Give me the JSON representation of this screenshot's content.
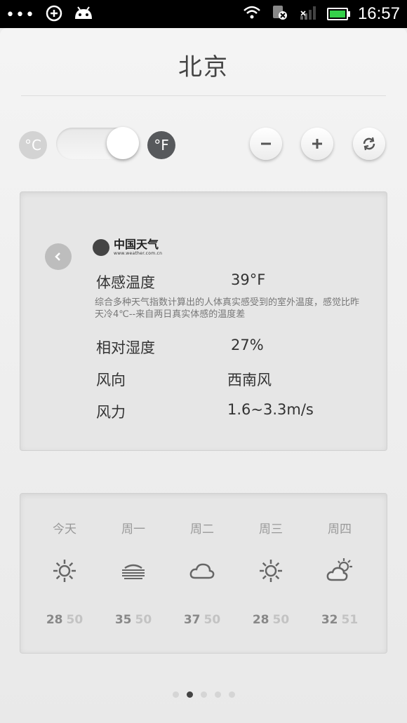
{
  "status_bar": {
    "time": "16:57",
    "dots": "•••",
    "icons": [
      "usb-debug-icon",
      "android-icon",
      "wifi-icon",
      "sim-error-icon",
      "signal-icon",
      "battery-icon"
    ]
  },
  "header": {
    "city": "北京"
  },
  "units": {
    "celsius": "°C",
    "fahrenheit": "°F",
    "selected": "fahrenheit"
  },
  "controls": {
    "minus": "−",
    "plus": "+"
  },
  "info_card": {
    "logo_name": "中国天气",
    "logo_url": "www.weather.com.cn",
    "rows": [
      {
        "label": "体感温度",
        "value": "39°F"
      },
      {
        "label": "相对湿度",
        "value": "27%"
      },
      {
        "label": "风向",
        "value": "西南风"
      },
      {
        "label": "风力",
        "value": "1.6~3.3m/s"
      }
    ],
    "description": "综合多种天气指数计算出的人体真实感受到的室外温度，感觉比昨天冷4℃--来自两日真实体感的温度差"
  },
  "forecast": [
    {
      "day": "今天",
      "icon": "sunny-icon",
      "low": "28",
      "high": "50"
    },
    {
      "day": "周一",
      "icon": "haze-icon",
      "low": "35",
      "high": "50"
    },
    {
      "day": "周二",
      "icon": "cloudy-icon",
      "low": "37",
      "high": "50"
    },
    {
      "day": "周三",
      "icon": "sunny-icon",
      "low": "28",
      "high": "50"
    },
    {
      "day": "周四",
      "icon": "partly-cloudy-icon",
      "low": "32",
      "high": "51"
    }
  ],
  "pager": {
    "pages": 5,
    "active_page": 2
  }
}
